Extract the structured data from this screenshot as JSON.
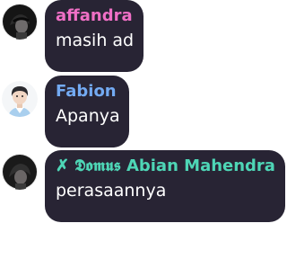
{
  "messages": [
    {
      "sender": "affandra",
      "sender_color": "#ef6fc5",
      "text": "masih ad",
      "avatar": "dark-portrait-avatar"
    },
    {
      "sender": "Fabion",
      "sender_color": "#73aaf2",
      "text": "Apanya",
      "avatar": "light-portrait-avatar"
    },
    {
      "sender_prefix": "✗ 𝕯𝖔𝖒𝖚𝖘",
      "sender": "Abian Mahendra",
      "sender_color": "#4ed6b6",
      "text": "perasaannya",
      "avatar": "dark-portrait-avatar"
    }
  ]
}
